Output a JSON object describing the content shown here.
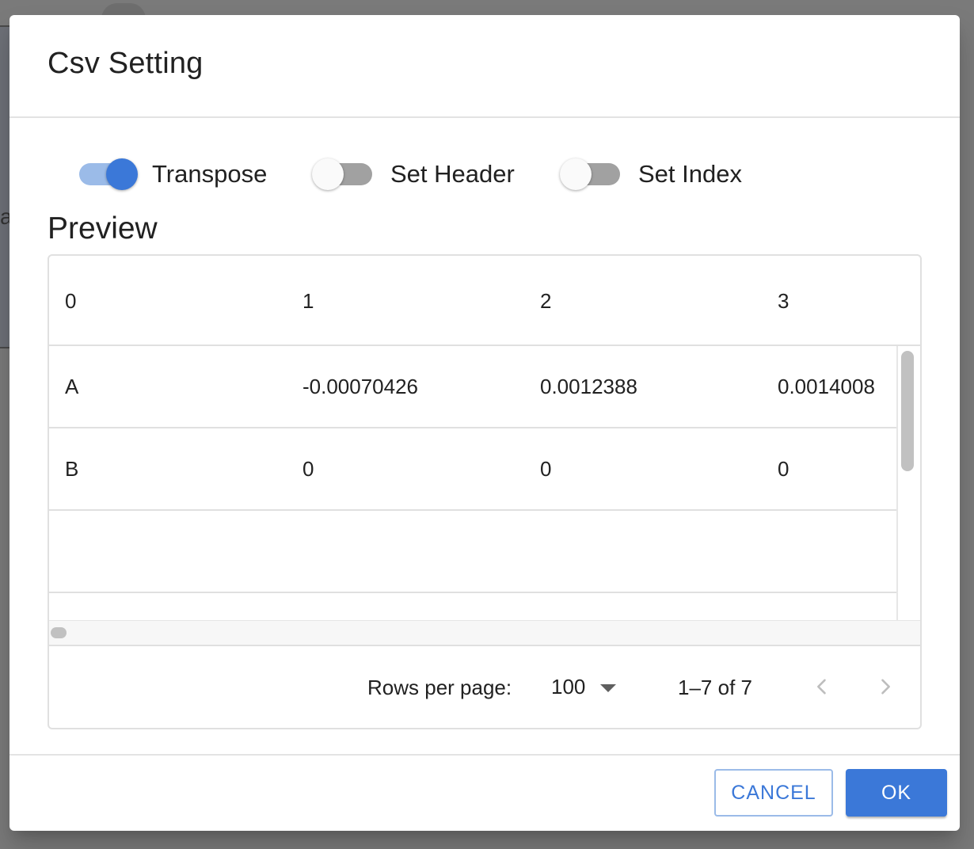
{
  "backdrop": {
    "partial_text": "a"
  },
  "dialog": {
    "title": "Csv Setting",
    "toggles": [
      {
        "label": "Transpose",
        "checked": true
      },
      {
        "label": "Set Header",
        "checked": false
      },
      {
        "label": "Set Index",
        "checked": false
      }
    ],
    "preview_heading": "Preview",
    "table": {
      "columns": [
        "0",
        "1",
        "2",
        "3"
      ],
      "rows": [
        [
          "A",
          "-0.00070426",
          "0.0012388",
          "0.0014008"
        ],
        [
          "B",
          "0",
          "0",
          "0"
        ],
        [
          "",
          "",
          "",
          ""
        ]
      ]
    },
    "pagination": {
      "rows_per_page_label": "Rows per page:",
      "rows_per_page_value": "100",
      "range_text": "1–7 of 7"
    },
    "buttons": {
      "cancel": "CANCEL",
      "ok": "OK"
    },
    "colors": {
      "accent": "#3b78d8",
      "accent_light": "#9bbbe8",
      "toggle_off": "#a1a1a1"
    },
    "icons": {
      "select": "caret-down-icon",
      "prev": "chevron-left-icon",
      "next": "chevron-right-icon"
    }
  }
}
